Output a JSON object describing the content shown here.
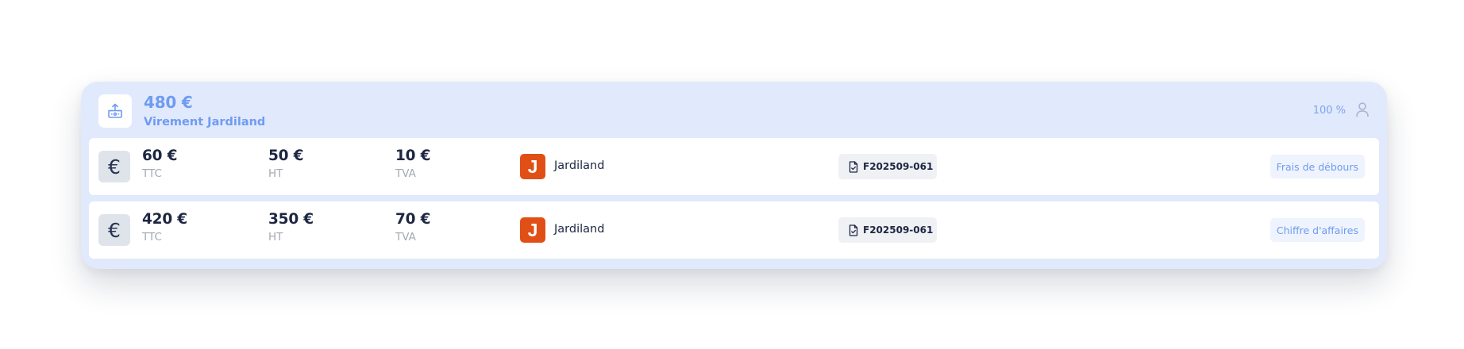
{
  "transaction": {
    "amount": "480 €",
    "label": "Virement Jardiland",
    "percent": "100 %",
    "icon": "bank-transfer-icon",
    "user_icon": "user-icon"
  },
  "lines": [
    {
      "icon_glyph": "€",
      "ttc_value": "60 €",
      "ttc_label": "TTC",
      "ht_value": "50 €",
      "ht_label": "HT",
      "tva_value": "10 €",
      "tva_label": "TVA",
      "supplier_initial": "J",
      "supplier_name": "Jardiland",
      "invoice": "F202509-061",
      "category": "Frais de débours"
    },
    {
      "icon_glyph": "€",
      "ttc_value": "420 €",
      "ttc_label": "TTC",
      "ht_value": "350 €",
      "ht_label": "HT",
      "tva_value": "70 €",
      "tva_label": "TVA",
      "supplier_initial": "J",
      "supplier_name": "Jardiland",
      "invoice": "F202509-061",
      "category": "Chiffre d'affaires"
    }
  ],
  "colors": {
    "accent": "#6f9bf2",
    "card_background": "#e1e9fc",
    "supplier_brand": "#e05016",
    "text_primary": "#1d2642",
    "text_muted": "#a4a9b3"
  }
}
